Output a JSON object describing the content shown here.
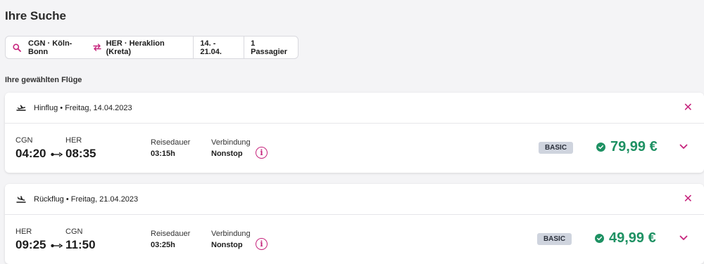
{
  "page": {
    "title": "Ihre Suche"
  },
  "search": {
    "from": "CGN · Köln-Bonn",
    "to": "HER · Heraklion (Kreta)",
    "dates": "14. - 21.04.",
    "passengers": "1 Passagier"
  },
  "selected_label": "Ihre gewählten Flüge",
  "colors": {
    "accent": "#c6237c",
    "price": "#1e9163",
    "badge_bg": "#cfd4de"
  },
  "flights": [
    {
      "header": "Hinflug • Freitag, 14.04.2023",
      "dep_code": "CGN",
      "dep_time": "04:20",
      "arr_code": "HER",
      "arr_time": "08:35",
      "duration_label": "Reisedauer",
      "duration": "03:15h",
      "connection_label": "Verbindung",
      "connection": "Nonstop",
      "fare": "BASIC",
      "price": "79,99 €",
      "icons": [
        "plane-departure-icon",
        "close-icon",
        "info-icon",
        "check-circle-icon",
        "chevron-down-icon"
      ]
    },
    {
      "header": "Rückflug • Freitag, 21.04.2023",
      "dep_code": "HER",
      "dep_time": "09:25",
      "arr_code": "CGN",
      "arr_time": "11:50",
      "duration_label": "Reisedauer",
      "duration": "03:25h",
      "connection_label": "Verbindung",
      "connection": "Nonstop",
      "fare": "BASIC",
      "price": "49,99 €",
      "icons": [
        "plane-arrival-icon",
        "close-icon",
        "info-icon",
        "check-circle-icon",
        "chevron-down-icon"
      ]
    }
  ]
}
